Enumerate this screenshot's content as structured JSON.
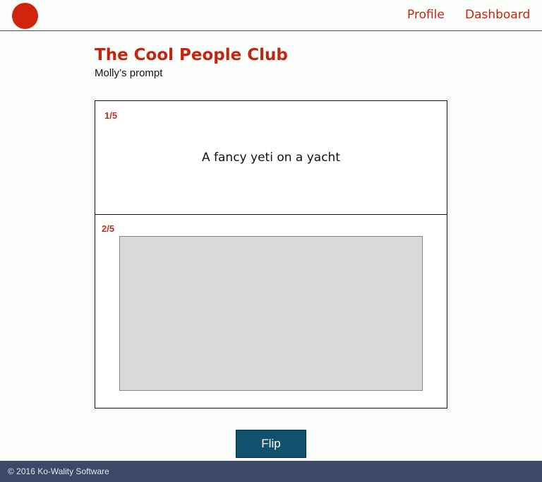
{
  "nav": {
    "profile_label": "Profile",
    "dashboard_label": "Dashboard"
  },
  "colors": {
    "brand_red": "#d0240c",
    "accent_text": "#c42510",
    "button_bg": "#10516d",
    "footer_bg": "#3c4867",
    "drawing_placeholder": "#d9d9d9"
  },
  "page": {
    "title": "The Cool People Club",
    "subtitle": "Molly’s prompt"
  },
  "cards": [
    {
      "step": "1/5",
      "prompt": "A fancy yeti on a yacht"
    },
    {
      "step": "2/5"
    }
  ],
  "actions": {
    "flip_label": "Flip"
  },
  "footer": {
    "text": "© 2016 Ko-Wality Software"
  }
}
